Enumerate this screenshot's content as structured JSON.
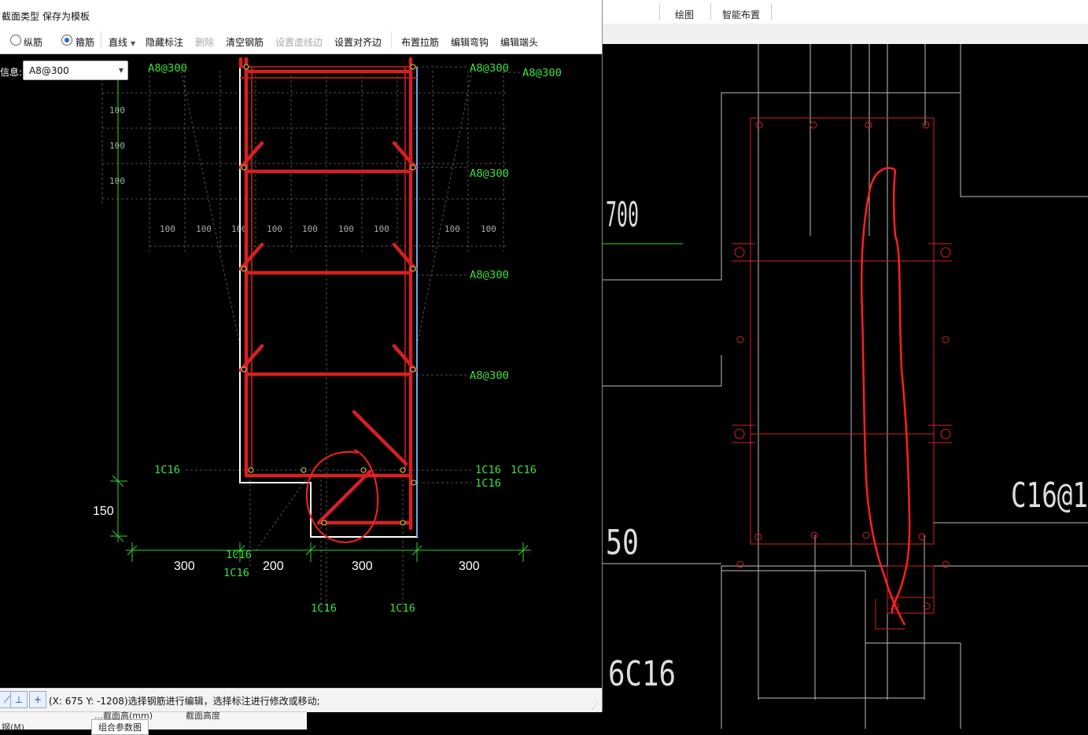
{
  "menu": {
    "section_type": "截面类型",
    "save_template": "保存为模板"
  },
  "toolbar": {
    "radio_longitudinal": "纵筋",
    "radio_stirrup": "箍筋",
    "line_mode": "直线",
    "hide_annotation": "隐藏标注",
    "delete": "删除",
    "clear_rebar": "清空钢筋",
    "set_dashed": "设置虚线边",
    "set_align": "设置对齐边",
    "place_tie": "布置拉筋",
    "edit_hook": "编辑弯钩",
    "edit_end": "编辑端头"
  },
  "info": {
    "label": "信息:",
    "value": "A8@300"
  },
  "drawing": {
    "stirrup_labels": [
      "A8@300",
      "A8@300",
      "A8@300",
      "A8@300",
      "A8@300"
    ],
    "grid_labels": [
      "100",
      "100",
      "100",
      "100",
      "100",
      "100",
      "100",
      "100",
      "100",
      "100",
      "100",
      "100"
    ],
    "rebar_labels_left": [
      "1C16",
      "1C16",
      "1C16"
    ],
    "rebar_labels_right": [
      "1C16",
      "1C16",
      "1C16"
    ],
    "rebar_labels_bottom": [
      "1C16",
      "1C16"
    ],
    "dim_vertical": "150",
    "dim_horizontal": [
      "300",
      "200",
      "300",
      "300"
    ]
  },
  "status": {
    "coords": "(X: 675 Y: -1208)选择钢筋进行编辑，选择标注进行修改或移动;"
  },
  "bottom": {
    "left_text": "钢(M)",
    "cell1": "…截面高(mm)",
    "cell2": "截面高度",
    "tab": "组合参数图"
  },
  "ribbon": {
    "tab_draw": "绘图",
    "tab_smart": "智能布置"
  },
  "cad": {
    "label_top": "700",
    "label_mid": "50",
    "label_bottom": "6C16",
    "label_right": "C16@1"
  },
  "colors": {
    "rebar": "#d62020",
    "cad_green": "#2ad62a",
    "stirrup_label": "#3be03b",
    "annotation_red": "#ff2020",
    "status_bg": "#f3f3f3"
  }
}
